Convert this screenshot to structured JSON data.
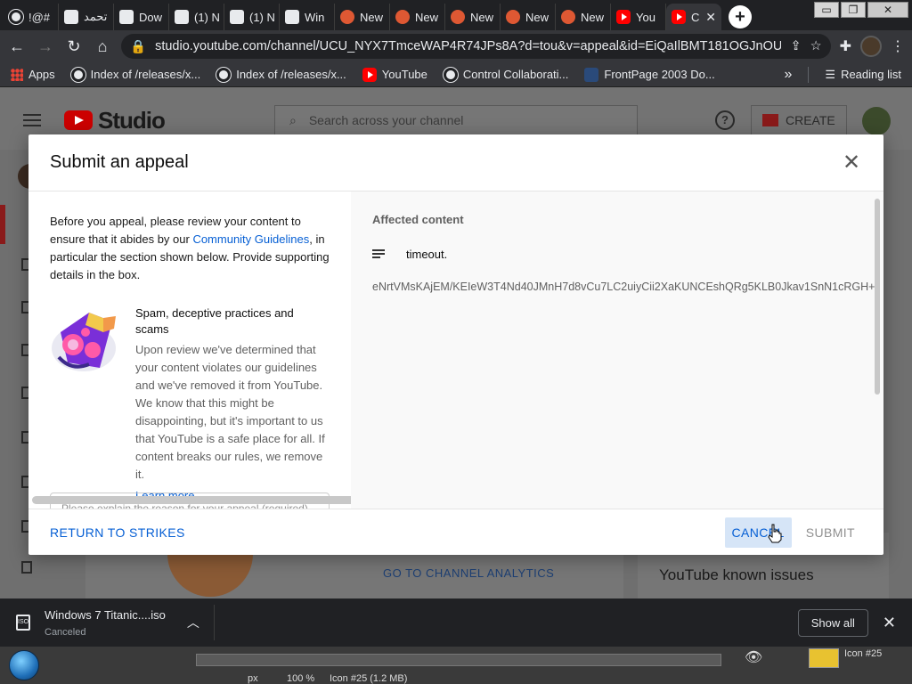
{
  "browser": {
    "tabs": [
      {
        "label": "!@#",
        "icon": "globe-icon"
      },
      {
        "label": "تحمد",
        "icon": "page-icon"
      },
      {
        "label": "Dow",
        "icon": "page-icon"
      },
      {
        "label": "(1) N",
        "icon": "page-icon"
      },
      {
        "label": "(1) N",
        "icon": "page-icon"
      },
      {
        "label": "Win",
        "icon": "page-icon"
      },
      {
        "label": "New",
        "icon": "duckduckgo-icon"
      },
      {
        "label": "New",
        "icon": "duckduckgo-icon"
      },
      {
        "label": "New",
        "icon": "duckduckgo-icon"
      },
      {
        "label": "New",
        "icon": "duckduckgo-icon"
      },
      {
        "label": "New",
        "icon": "duckduckgo-icon"
      },
      {
        "label": "You",
        "icon": "youtube-icon"
      }
    ],
    "active_tab": {
      "label": "C",
      "icon": "youtube-icon",
      "close": "✕"
    },
    "new_tab": "+",
    "window_controls": {
      "minimize": "▭",
      "maximize": "❐",
      "close": "✕"
    },
    "nav": {
      "back": "←",
      "forward": "→",
      "reload": "↻",
      "home": "⌂"
    },
    "url": "studio.youtube.com/channel/UCU_NYX7TmceWAP4R74JPs8A?d=tou&v=appeal&id=EiQaIlBMT181OGJnOU...",
    "bookmarks": [
      {
        "label": "Apps",
        "icon": "apps-grid-icon"
      },
      {
        "label": "Index of /releases/x...",
        "icon": "globe-icon"
      },
      {
        "label": "Index of /releases/x...",
        "icon": "globe-icon"
      },
      {
        "label": "YouTube",
        "icon": "youtube-icon"
      },
      {
        "label": "Control Collaborati...",
        "icon": "globe-icon"
      },
      {
        "label": "FrontPage 2003 Do...",
        "icon": "page-icon"
      }
    ],
    "bookmarks_more": "»",
    "reading_list": "Reading list"
  },
  "studio": {
    "wordmark": "Studio",
    "search_placeholder": "Search across your channel",
    "help": "?",
    "create": "CREATE",
    "go_analytics": "GO TO CHANNEL ANALYTICS",
    "known_issues": "YouTube known issues"
  },
  "modal": {
    "title": "Submit an appeal",
    "close": "✕",
    "intro_before": "Before you appeal, please review your content to ensure that it abides by our ",
    "intro_link": "Community Guidelines",
    "intro_after": ", in particular the section shown below. Provide supporting details in the box.",
    "policy_title": "Spam, deceptive practices and scams",
    "policy_desc": "Upon review we've determined that your content violates our guidelines and we've removed it from YouTube. We know that this might be disappointing, but it's important to us that YouTube is a safe place for all. If content breaks our rules, we remove it.",
    "learn_more": "Learn more",
    "reason_placeholder": "Please explain the reason for your appeal (required)",
    "affected_label": "Affected content",
    "affected_title": "timeout.",
    "content_id": "eNrtVMsKAjEM/KEIeW3T4Nd40JMnH7d8vCu7LC2uiyCii2XaKUNCEshQRg5KLB0Jkav1SnN1cRGH+",
    "return_label": "RETURN TO STRIKES",
    "cancel_label": "CANCEL",
    "submit_label": "SUBMIT"
  },
  "downloads": {
    "file_name": "Windows 7 Titanic....iso",
    "file_type": "ISO",
    "status": "Canceled",
    "show_all": "Show all",
    "close": "✕"
  },
  "taskbar": {
    "zoom_unit": "px",
    "zoom": "100 %",
    "image_info": "Icon #25 (1.2 MB)",
    "layer_name": "Icon #25"
  },
  "colors": {
    "link": "#065fd4",
    "youtube_red": "#ff0000",
    "cancel_bg": "#d6e5f7"
  }
}
